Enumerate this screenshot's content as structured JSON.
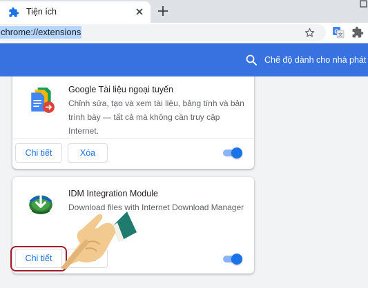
{
  "tab": {
    "title": "Tiện ích",
    "icon": "puzzle-icon"
  },
  "toolbar": {
    "url": "chrome://extensions"
  },
  "header": {
    "developer_mode_label": "Chế độ dành cho nhà phát triể"
  },
  "extensions": [
    {
      "name": "Google Tài liệu ngoại tuyến",
      "description": "Chỉnh sửa, tạo và xem tài liệu, bảng tính và bản trình bày — tất cả mà không cần truy cập Internet.",
      "details_label": "Chi tiết",
      "remove_label": "Xóa",
      "enabled": true
    },
    {
      "name": "IDM Integration Module",
      "description": "Download files with Internet Download Manager",
      "details_label": "Chi tiết",
      "remove_label": "Xóa",
      "enabled": true
    }
  ],
  "colors": {
    "header": "#3871e0",
    "accent": "#1a73e8",
    "highlight_outline": "#a31c2b"
  }
}
